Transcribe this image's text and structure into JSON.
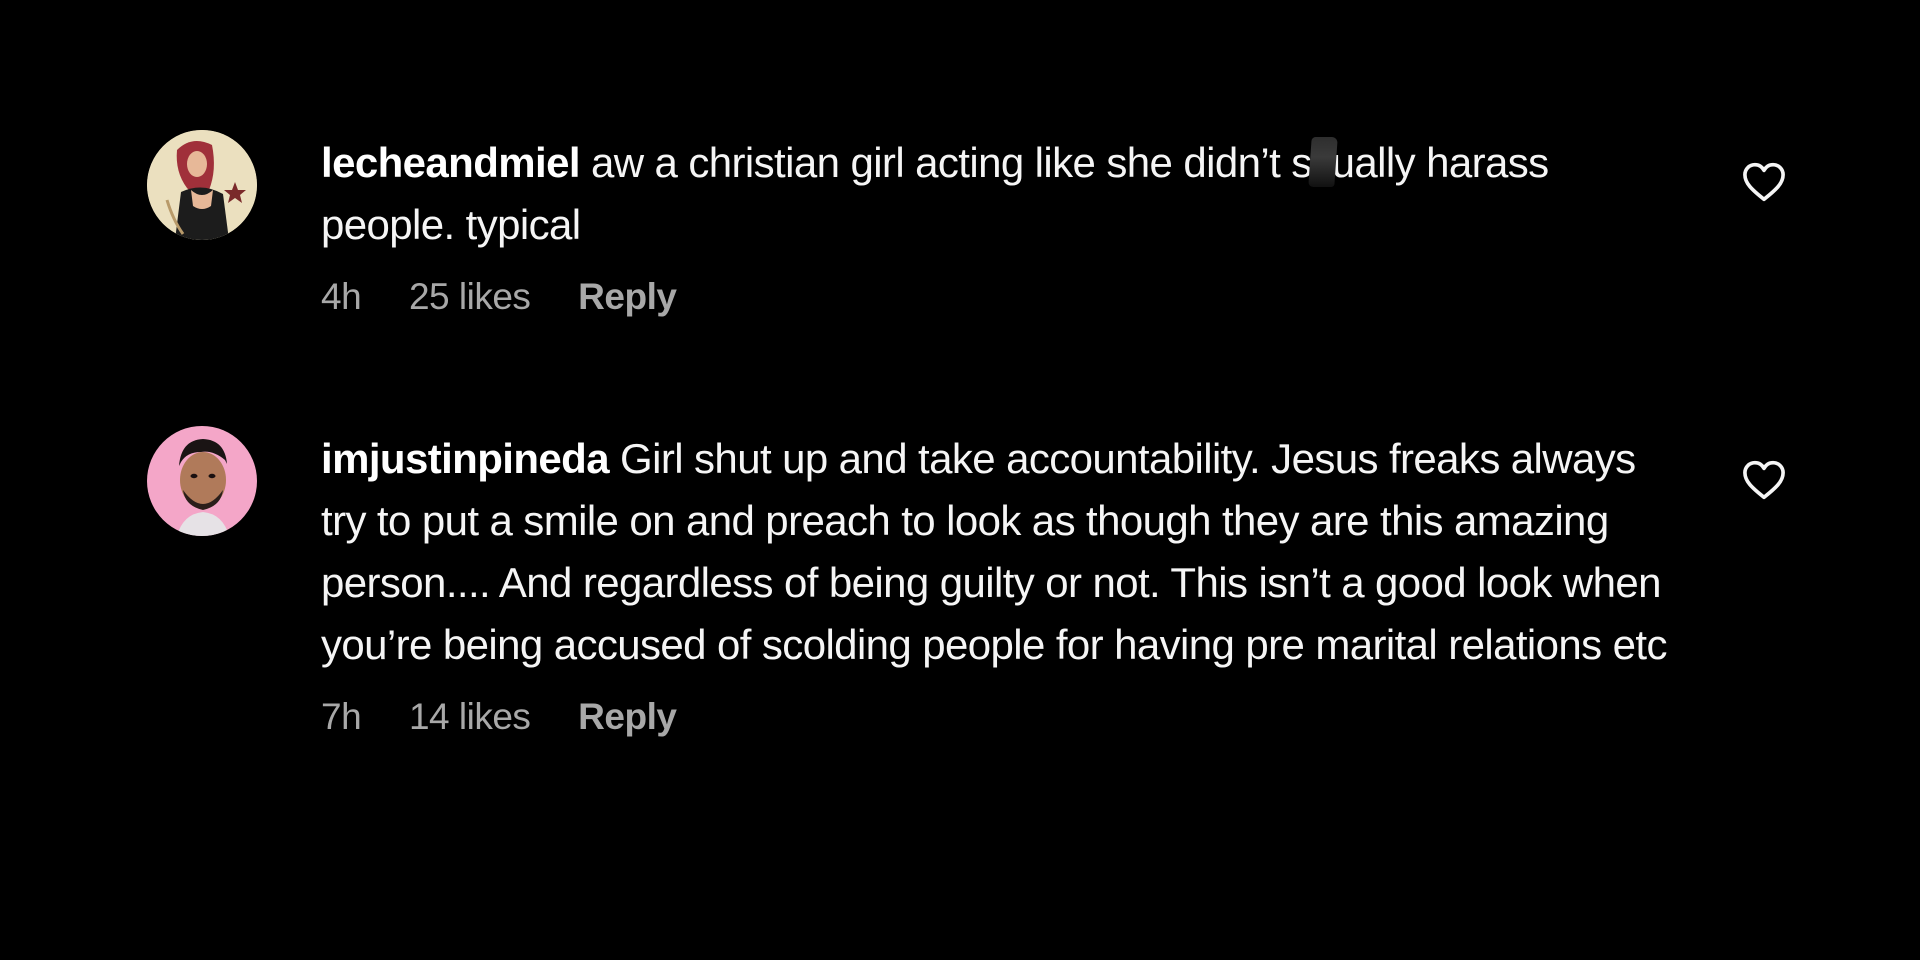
{
  "comments": [
    {
      "username": "lecheandmiel",
      "text_before_censor": "aw a christian girl acting like she didn’t s",
      "text_after_censor": "ually harass people. typical",
      "time": "4h",
      "likes": "25 likes",
      "reply_label": "Reply",
      "avatar_icon": "profile-photo-illustrated-woman-with-star",
      "like_icon": "heart-outline-icon"
    },
    {
      "username": "imjustinpineda",
      "text": "Girl shut up and take accountability. Jesus freaks always try to put a smile on and preach to look as though they are this amazing person.... And regardless of being guilty or not. This isn’t a good look when you’re being accused of scolding people for having pre marital relations etc",
      "time": "7h",
      "likes": "14 likes",
      "reply_label": "Reply",
      "avatar_icon": "profile-photo-man-on-pink-background",
      "like_icon": "heart-outline-icon"
    }
  ],
  "colors": {
    "background": "#000000",
    "text": "#f5f5f5",
    "meta_text": "#a8a8a8",
    "avatar_2_bg": "#f4a6c8"
  }
}
